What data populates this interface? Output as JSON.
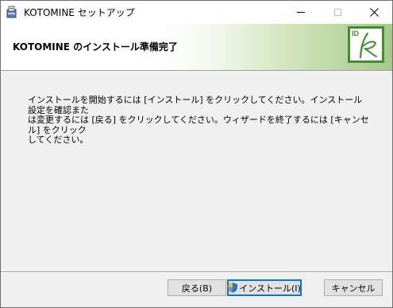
{
  "window": {
    "title": "KOTOMINE セットアップ",
    "icons": {
      "app": "setup-box-icon",
      "minimize": "minimize-icon",
      "maximize": "maximize-icon",
      "close": "close-icon"
    }
  },
  "banner": {
    "title": "KOTOMINE のインストール準備完了",
    "logo_text": "ID",
    "logo_icon": "kotomine-logo-icon",
    "colors": {
      "logo_green": "#3f8f2e",
      "gradient_end": "#a6c98a"
    }
  },
  "body": {
    "message": "インストールを開始するには [インストール] をクリックしてください。インストール設定を確認また\nは変更するには [戻る] をクリックしてください。ウィザードを終了するには [キャンセル] をクリック\nしてください。"
  },
  "buttons": {
    "back_label": "戻る(B)",
    "install_label": "インストール(I)",
    "install_icon": "uac-shield-icon",
    "cancel_label": "キャンセル",
    "colors": {
      "focus_border": "#0078d7"
    }
  }
}
